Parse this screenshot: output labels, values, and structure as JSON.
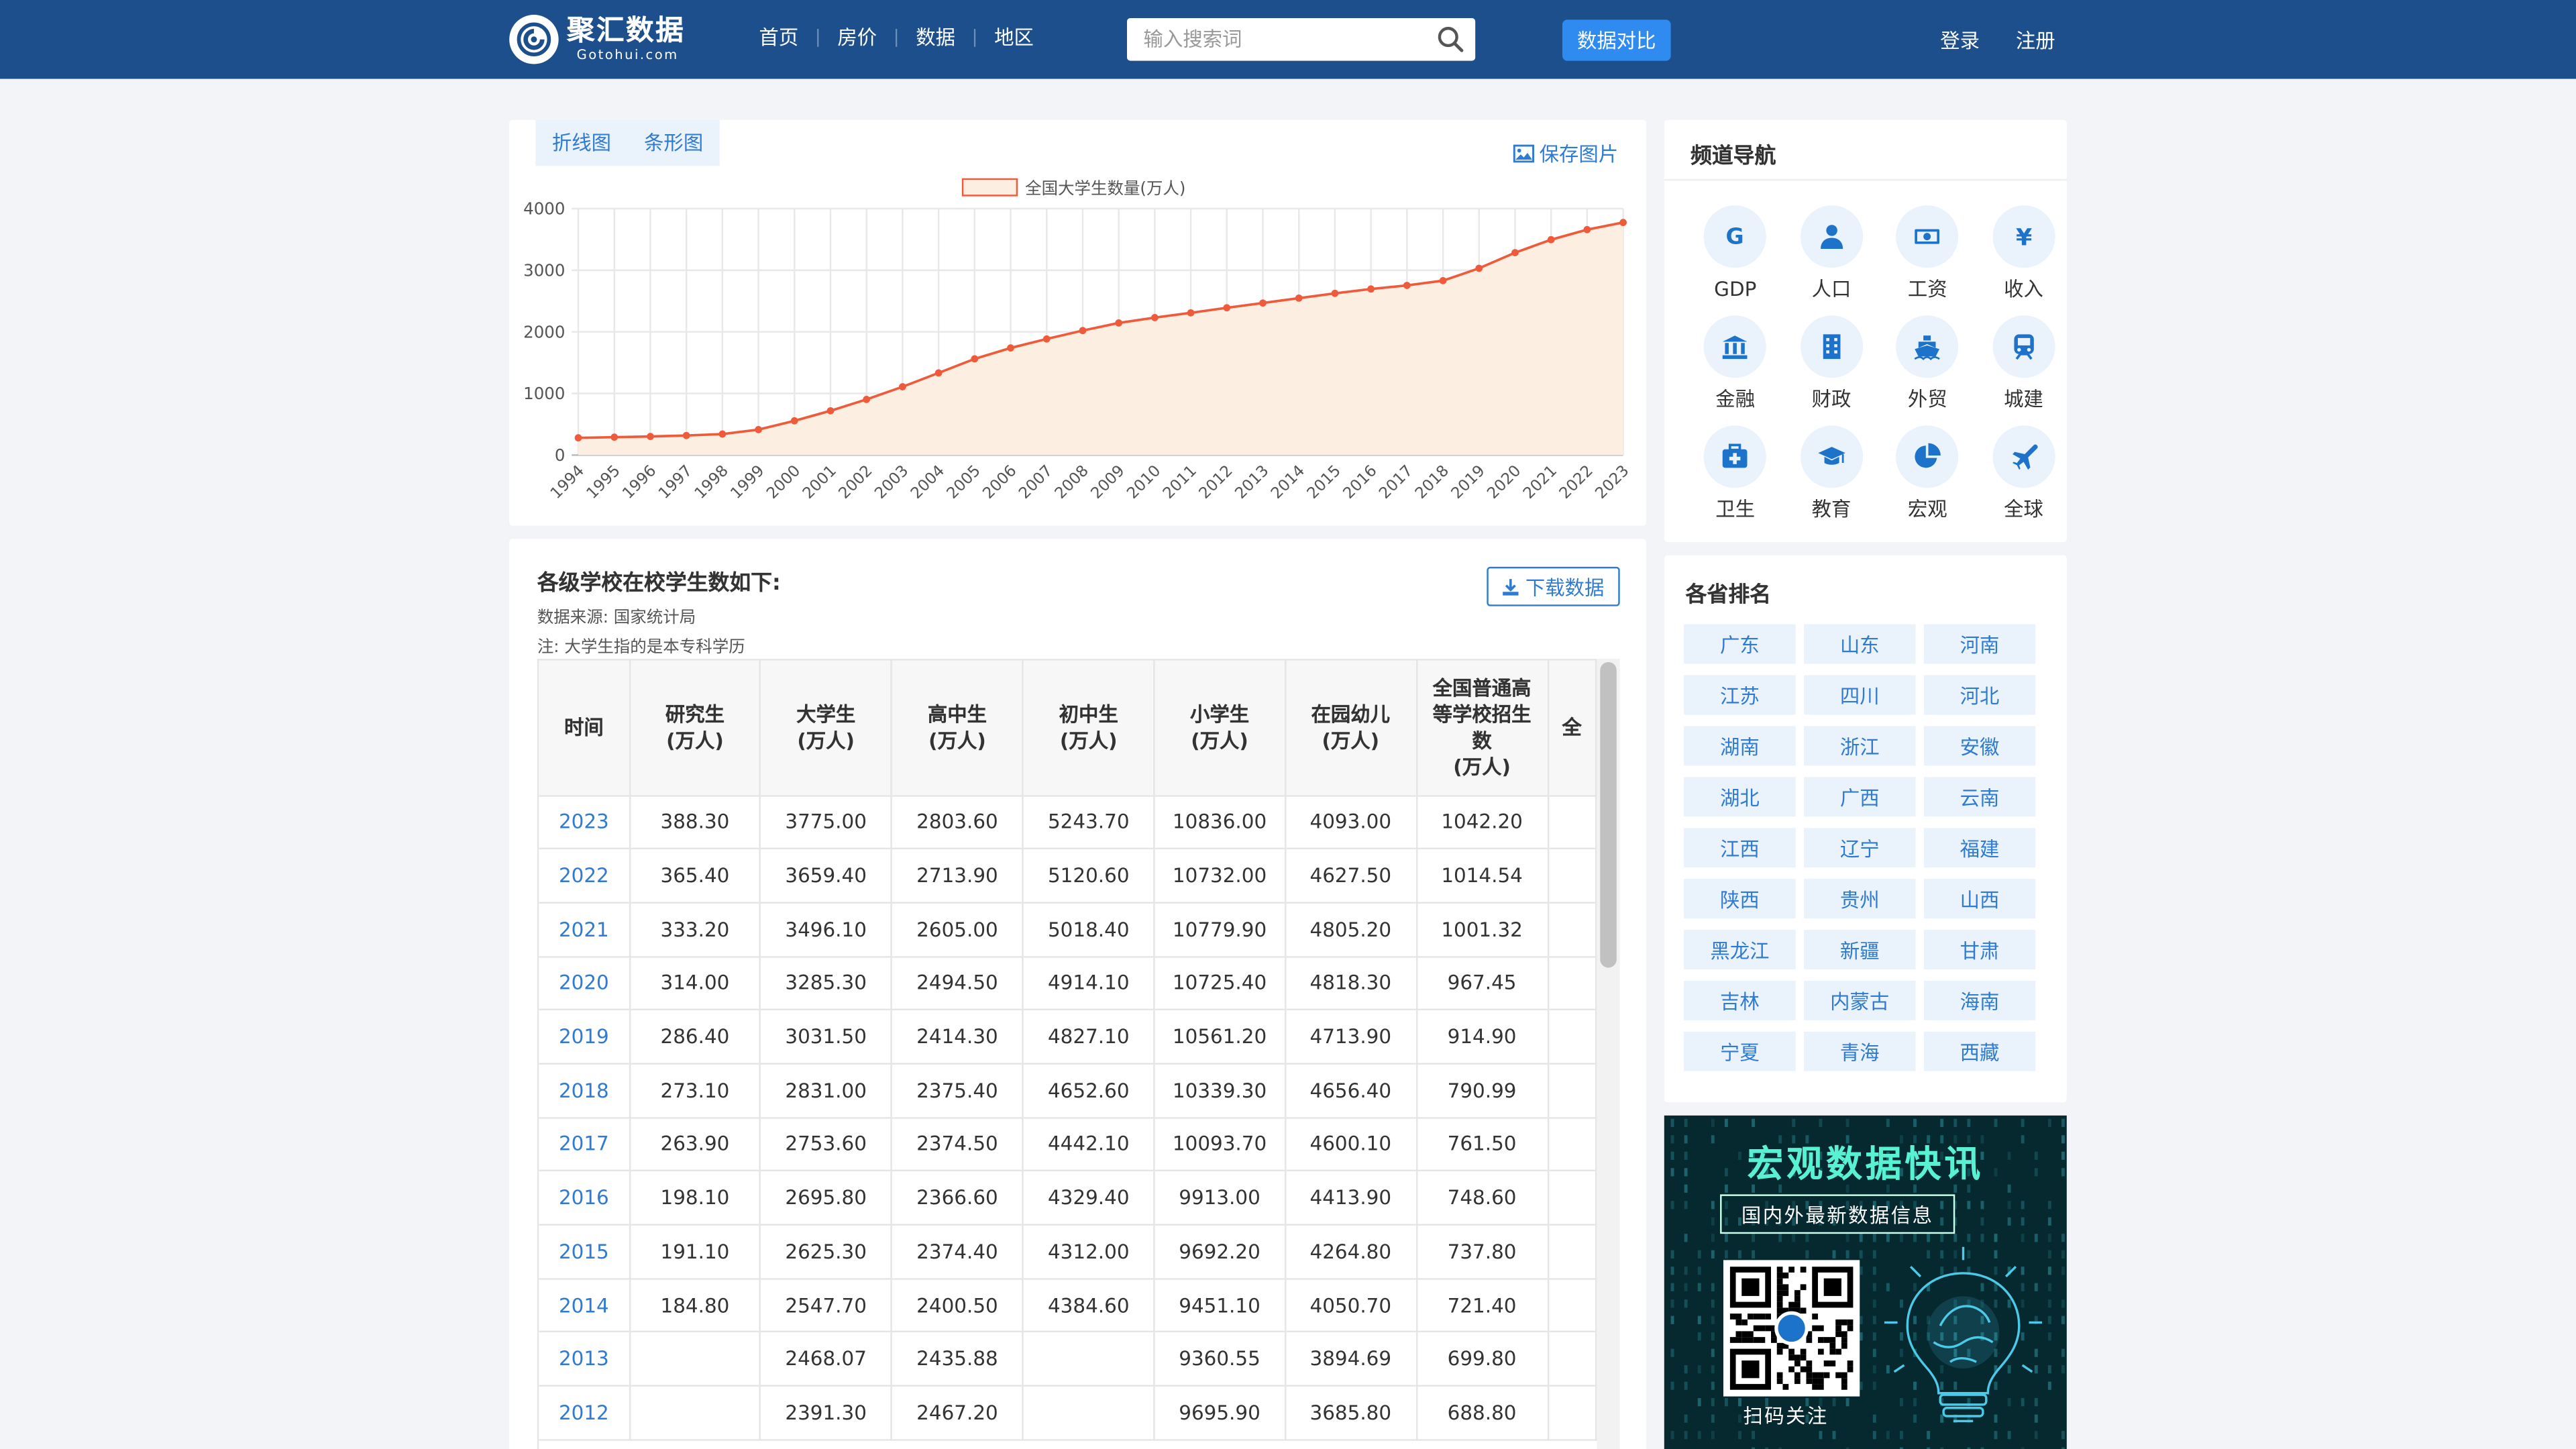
{
  "header": {
    "logo_title": "聚汇数据",
    "logo_sub": "Gotohui.com",
    "nav": [
      "首页",
      "房价",
      "数据",
      "地区"
    ],
    "search_placeholder": "输入搜索词",
    "compare": "数据对比",
    "login": "登录",
    "register": "注册"
  },
  "chart": {
    "tabs": [
      "折线图",
      "条形图"
    ],
    "save": "保存图片"
  },
  "chart_data": {
    "type": "area",
    "legend": "全国大学生数量(万人)",
    "legend_position": "top-center",
    "color": "#ef5b3a",
    "fill": "#fdeee2",
    "ylim": [
      0,
      4000
    ],
    "yticks": [
      0,
      1000,
      2000,
      3000,
      4000
    ],
    "grid": true,
    "x": [
      "1994",
      "1995",
      "1996",
      "1997",
      "1998",
      "1999",
      "2000",
      "2001",
      "2002",
      "2003",
      "2004",
      "2005",
      "2006",
      "2007",
      "2008",
      "2009",
      "2010",
      "2011",
      "2012",
      "2013",
      "2014",
      "2015",
      "2016",
      "2017",
      "2018",
      "2019",
      "2020",
      "2021",
      "2022",
      "2023"
    ],
    "values": [
      279.9,
      290.6,
      302.1,
      317.4,
      340.9,
      413.4,
      556.1,
      719.1,
      903.4,
      1108.6,
      1333.5,
      1561.8,
      1738.8,
      1884.9,
      2021.0,
      2144.7,
      2231.8,
      2308.5,
      2391.3,
      2468.07,
      2547.7,
      2625.3,
      2695.8,
      2753.6,
      2831.0,
      3031.5,
      3285.3,
      3496.1,
      3659.4,
      3775.0
    ]
  },
  "table": {
    "title": "各级学校在校学生数如下:",
    "source": "数据来源: 国家统计局",
    "note": "注: 大学生指的是本专科学历",
    "download": "下载数据",
    "headers": [
      "时间",
      "研究生\n(万人)",
      "大学生\n(万人)",
      "高中生\n(万人)",
      "初中生\n(万人)",
      "小学生\n(万人)",
      "在园幼儿\n(万人)",
      "全国普通高等学校招生数\n(万人)",
      "全"
    ],
    "rows": [
      [
        "2023",
        "388.30",
        "3775.00",
        "2803.60",
        "5243.70",
        "10836.00",
        "4093.00",
        "1042.20"
      ],
      [
        "2022",
        "365.40",
        "3659.40",
        "2713.90",
        "5120.60",
        "10732.00",
        "4627.50",
        "1014.54"
      ],
      [
        "2021",
        "333.20",
        "3496.10",
        "2605.00",
        "5018.40",
        "10779.90",
        "4805.20",
        "1001.32"
      ],
      [
        "2020",
        "314.00",
        "3285.30",
        "2494.50",
        "4914.10",
        "10725.40",
        "4818.30",
        "967.45"
      ],
      [
        "2019",
        "286.40",
        "3031.50",
        "2414.30",
        "4827.10",
        "10561.20",
        "4713.90",
        "914.90"
      ],
      [
        "2018",
        "273.10",
        "2831.00",
        "2375.40",
        "4652.60",
        "10339.30",
        "4656.40",
        "790.99"
      ],
      [
        "2017",
        "263.90",
        "2753.60",
        "2374.50",
        "4442.10",
        "10093.70",
        "4600.10",
        "761.50"
      ],
      [
        "2016",
        "198.10",
        "2695.80",
        "2366.60",
        "4329.40",
        "9913.00",
        "4413.90",
        "748.60"
      ],
      [
        "2015",
        "191.10",
        "2625.30",
        "2374.40",
        "4312.00",
        "9692.20",
        "4264.80",
        "737.80"
      ],
      [
        "2014",
        "184.80",
        "2547.70",
        "2400.50",
        "4384.60",
        "9451.10",
        "4050.70",
        "721.40"
      ],
      [
        "2013",
        "",
        "2468.07",
        "2435.88",
        "",
        "9360.55",
        "3894.69",
        "699.80"
      ],
      [
        "2012",
        "",
        "2391.30",
        "2467.20",
        "",
        "9695.90",
        "3685.80",
        "688.80"
      ]
    ]
  },
  "channel": {
    "title": "频道导航",
    "items": [
      {
        "label": "GDP",
        "icon": "gdp-g-icon"
      },
      {
        "label": "人口",
        "icon": "person-icon"
      },
      {
        "label": "工资",
        "icon": "banknote-icon"
      },
      {
        "label": "收入",
        "icon": "yen-icon"
      },
      {
        "label": "金融",
        "icon": "bank-icon"
      },
      {
        "label": "财政",
        "icon": "building-icon"
      },
      {
        "label": "外贸",
        "icon": "ship-icon"
      },
      {
        "label": "城建",
        "icon": "train-icon"
      },
      {
        "label": "卫生",
        "icon": "medkit-icon"
      },
      {
        "label": "教育",
        "icon": "graduation-cap-icon"
      },
      {
        "label": "宏观",
        "icon": "pie-chart-icon"
      },
      {
        "label": "全球",
        "icon": "plane-icon"
      }
    ]
  },
  "provinces": {
    "title": "各省排名",
    "items": [
      "广东",
      "山东",
      "河南",
      "江苏",
      "四川",
      "河北",
      "湖南",
      "浙江",
      "安徽",
      "湖北",
      "广西",
      "云南",
      "江西",
      "辽宁",
      "福建",
      "陕西",
      "贵州",
      "山西",
      "黑龙江",
      "新疆",
      "甘肃",
      "吉林",
      "内蒙古",
      "海南",
      "宁夏",
      "青海",
      "西藏"
    ]
  },
  "ad": {
    "title": "宏观数据快讯",
    "subtitle": "国内外最新数据信息",
    "scan": "扫码关注"
  }
}
